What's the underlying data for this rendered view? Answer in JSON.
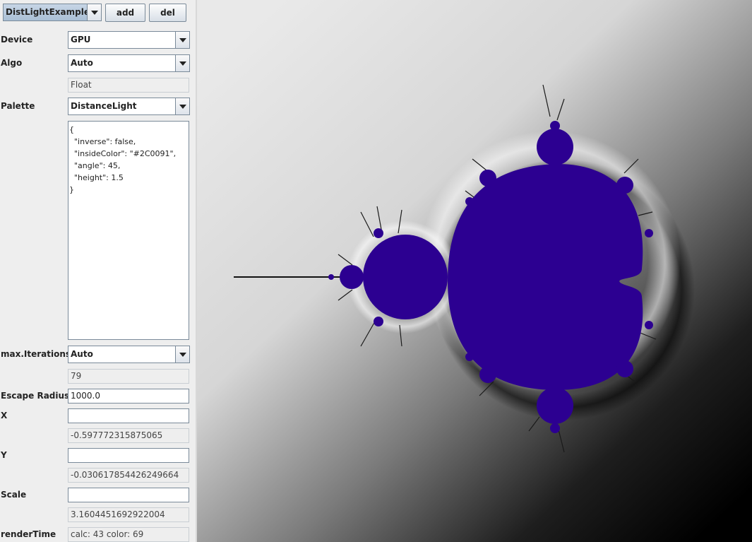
{
  "window": {
    "preset": "DistLightExample",
    "add_label": "add",
    "del_label": "del"
  },
  "settings": {
    "device": {
      "label": "Device",
      "value": "GPU"
    },
    "algo": {
      "label": "Algo",
      "value": "Auto",
      "precision": "Float"
    },
    "palette": {
      "label": "Palette",
      "value": "DistanceLight",
      "params": "{\n  \"inverse\": false,\n  \"insideColor\": \"#2C0091\",\n  \"angle\": 45,\n  \"height\": 1.5\n}"
    },
    "max_iterations": {
      "label": "max.Iterations",
      "value": "Auto",
      "computed": "79"
    },
    "escape_radius": {
      "label": "Escape Radius",
      "value": "1000.0"
    },
    "x": {
      "label": "X",
      "value": "",
      "computed": "-0.597772315875065"
    },
    "y": {
      "label": "Y",
      "value": "",
      "computed": "-0.030617854426249664"
    },
    "scale": {
      "label": "Scale",
      "value": "",
      "computed": "3.1604451692922004"
    },
    "render_time": {
      "label": "renderTime",
      "value": "calc: 43 color: 69"
    }
  },
  "render": {
    "inside_color": "#2C0091",
    "background_light": "#ffffff",
    "background_dark": "#000000"
  }
}
